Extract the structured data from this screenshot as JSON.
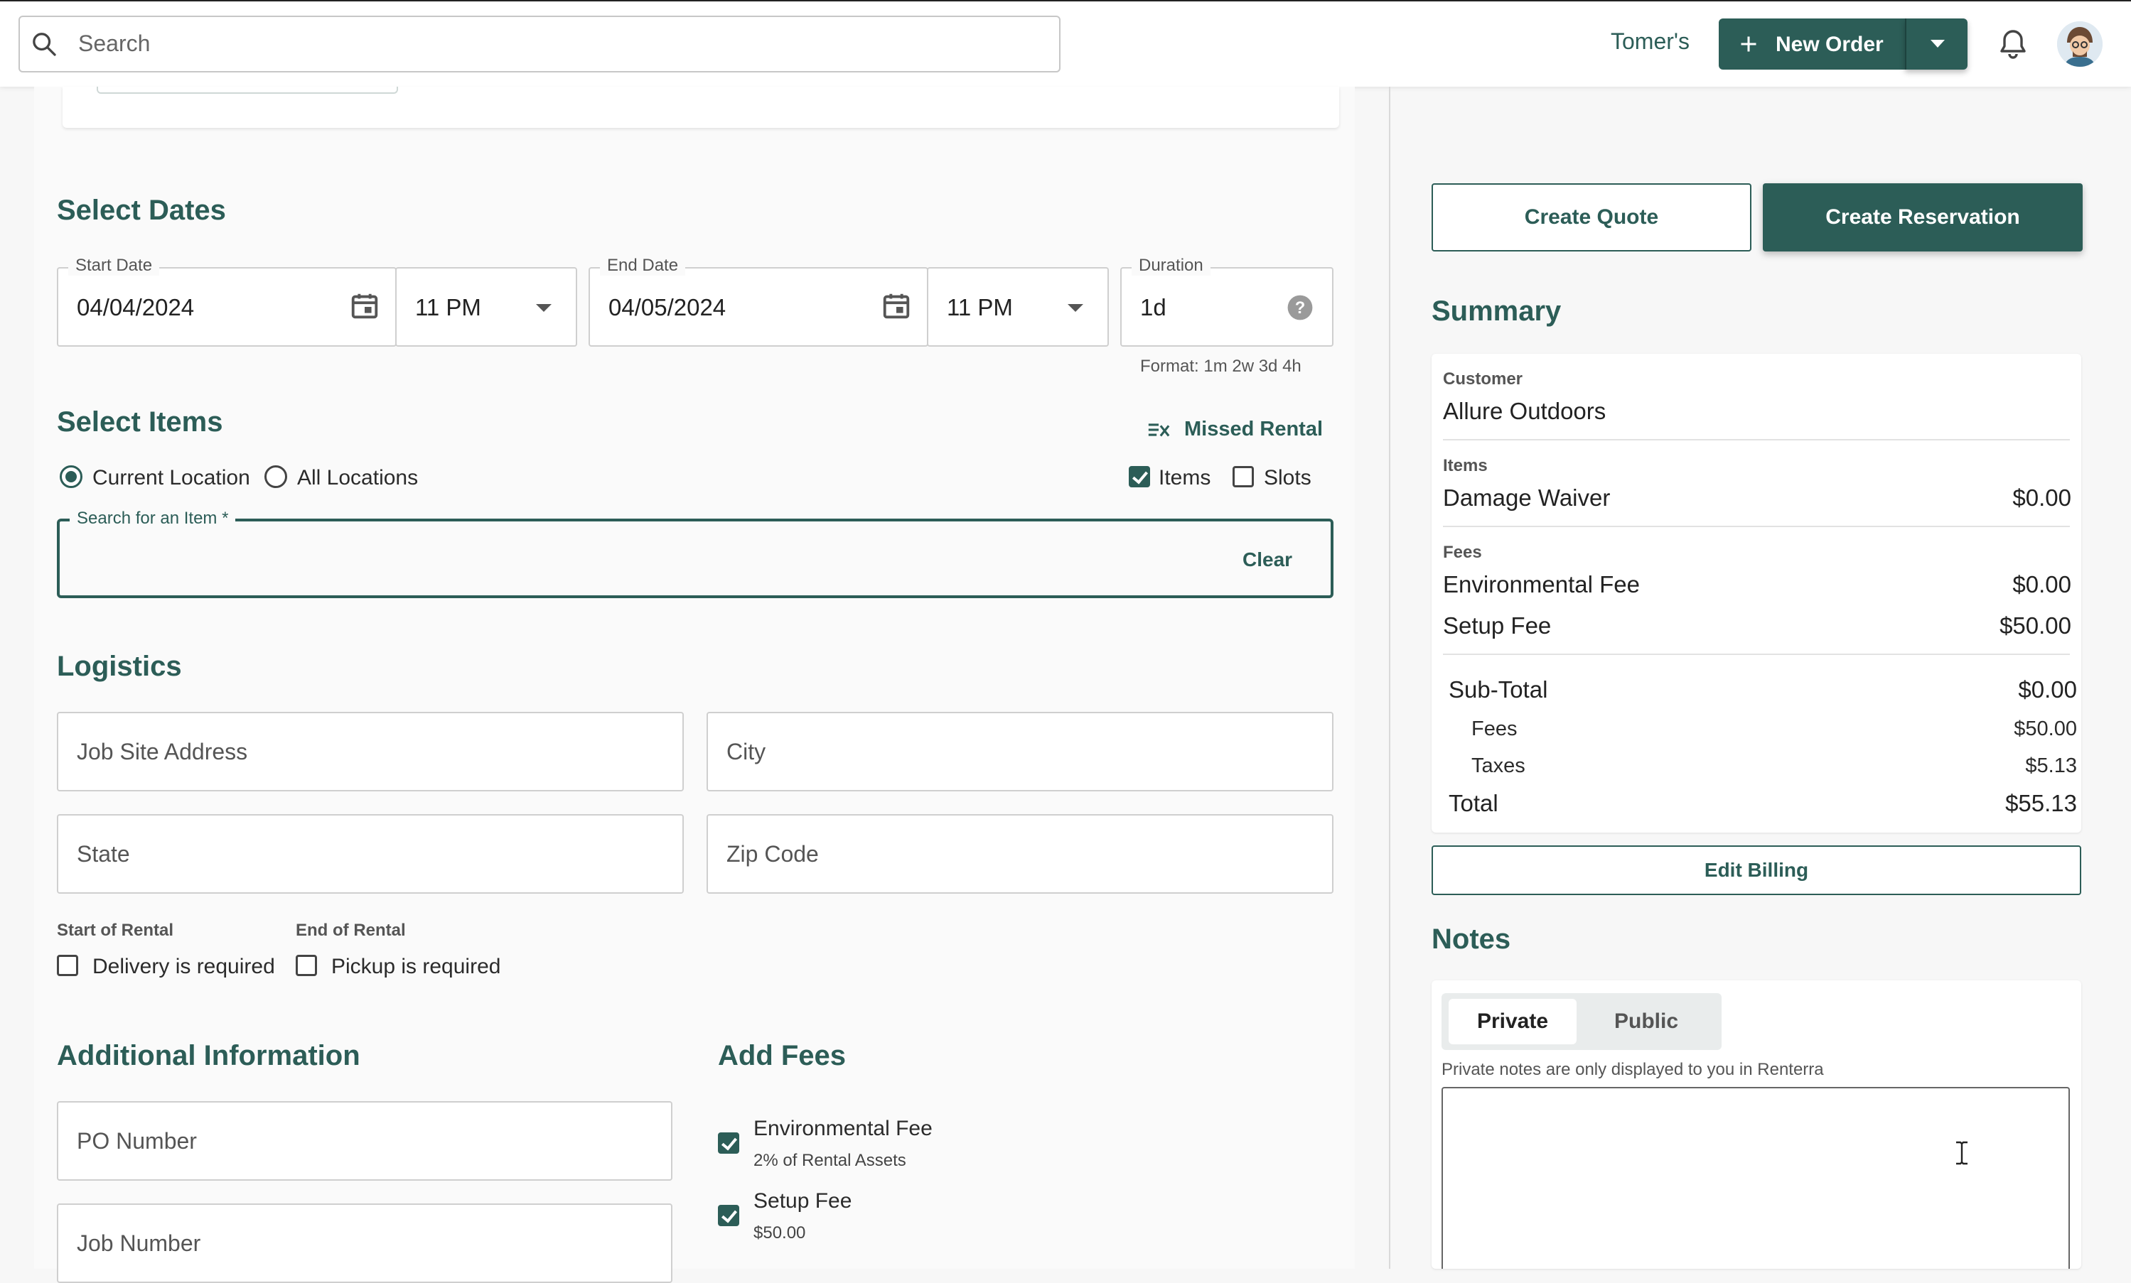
{
  "header": {
    "search_placeholder": "Search",
    "store_name": "Tomer's",
    "new_order_label": "New Order"
  },
  "select_dates": {
    "title": "Select Dates",
    "start_date_label": "Start Date",
    "start_date_value": "04/04/2024",
    "start_time_value": "11 PM",
    "end_date_label": "End Date",
    "end_date_value": "04/05/2024",
    "end_time_value": "11 PM",
    "duration_label": "Duration",
    "duration_value": "1d",
    "duration_hint": "Format: 1m 2w 3d 4h"
  },
  "select_items": {
    "title": "Select Items",
    "missed_rental_label": "Missed Rental",
    "current_location_label": "Current Location",
    "all_locations_label": "All Locations",
    "items_label": "Items",
    "slots_label": "Slots",
    "search_label": "Search for an Item *",
    "clear_label": "Clear"
  },
  "logistics": {
    "title": "Logistics",
    "job_site_address_placeholder": "Job Site Address",
    "city_placeholder": "City",
    "state_placeholder": "State",
    "zip_placeholder": "Zip Code",
    "start_of_rental_label": "Start of Rental",
    "delivery_label": "Delivery is required",
    "end_of_rental_label": "End of Rental",
    "pickup_label": "Pickup is required"
  },
  "additional_info": {
    "title": "Additional Information",
    "po_number_placeholder": "PO Number",
    "job_number_placeholder": "Job Number"
  },
  "add_fees": {
    "title": "Add Fees",
    "fees": [
      {
        "name": "Environmental Fee",
        "detail": "2% of Rental Assets",
        "checked": true
      },
      {
        "name": "Setup Fee",
        "detail": "$50.00",
        "checked": true
      }
    ]
  },
  "actions": {
    "create_quote": "Create Quote",
    "create_reservation": "Create Reservation"
  },
  "summary": {
    "title": "Summary",
    "customer_label": "Customer",
    "customer_value": "Allure Outdoors",
    "items_label": "Items",
    "items": [
      {
        "name": "Damage Waiver",
        "amount": "$0.00"
      }
    ],
    "fees_label": "Fees",
    "fees": [
      {
        "name": "Environmental Fee",
        "amount": "$0.00"
      },
      {
        "name": "Setup Fee",
        "amount": "$50.00"
      }
    ],
    "subtotal_label": "Sub-Total",
    "subtotal_value": "$0.00",
    "fees_total_label": "Fees",
    "fees_total_value": "$50.00",
    "taxes_label": "Taxes",
    "taxes_value": "$5.13",
    "total_label": "Total",
    "total_value": "$55.13",
    "edit_billing_label": "Edit Billing"
  },
  "notes": {
    "title": "Notes",
    "tab_private": "Private",
    "tab_public": "Public",
    "hint": "Private notes are only displayed to you in Renterra"
  },
  "colors": {
    "accent": "#2c5d57"
  }
}
